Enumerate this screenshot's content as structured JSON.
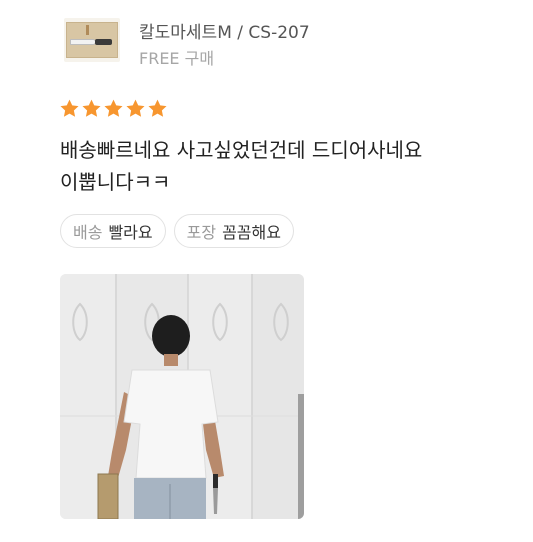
{
  "product": {
    "name": "칼도마세트M / CS-207",
    "option": "FREE  구매",
    "thumbnail_icon": "knife-cutting-board-thumbnail"
  },
  "rating": {
    "stars": 5,
    "max": 5,
    "color": "#F7962F"
  },
  "review": {
    "lines": [
      "배송빠르네요 사고싶었던건데 드디어사네요",
      "이뿝니다ㅋㅋ"
    ]
  },
  "tags": [
    {
      "key": "배송",
      "value": "빨라요"
    },
    {
      "key": "포장",
      "value": "꼼꼼해요"
    }
  ],
  "photo": {
    "icon": "review-photo-person-holding-knife-and-board"
  }
}
